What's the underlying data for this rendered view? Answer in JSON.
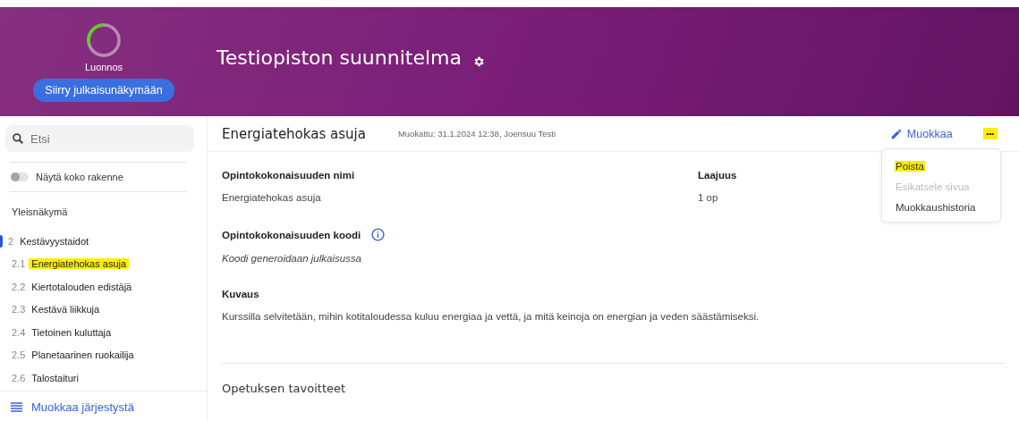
{
  "header": {
    "status": {
      "label": "Luonnos",
      "level": 0.3
    },
    "publish_button": "Siirry julkaisunäkymään",
    "title": "Testiopiston suunnitelma"
  },
  "sidebar": {
    "search": {
      "placeholder": "Etsi"
    },
    "toggle": {
      "label": "Näytä koko rakenne",
      "on": false
    },
    "overview": "Yleisnäkymä",
    "items": [
      {
        "number": "2",
        "label": "Kestävyystaidot",
        "active": true,
        "selected": false,
        "children": [
          {
            "number": "2.1",
            "label": "Energiatehokas asuja",
            "selected": true
          },
          {
            "number": "2.2",
            "label": "Kiertotalouden edistäjä",
            "selected": false
          },
          {
            "number": "2.3",
            "label": "Kestävä liikkuja",
            "selected": false
          },
          {
            "number": "2.4",
            "label": "Tietoinen kuluttaja",
            "selected": false
          },
          {
            "number": "2.5",
            "label": "Planetaarinen ruokailija",
            "selected": false
          },
          {
            "number": "2.6",
            "label": "Talostaituri",
            "selected": false
          }
        ]
      }
    ],
    "reorder_link": "Muokkaa järjestystä"
  },
  "content": {
    "title": "Energiatehokas asuja",
    "modified": "Muokattu: 31.1.2024 12:38, Joensuu Testi",
    "edit_button": "Muokkaa",
    "more_button": {
      "label": "•••",
      "highlighted": true
    },
    "menu": [
      {
        "label": "Poista",
        "highlighted": true,
        "disabled": false
      },
      {
        "label": "Esikatsele sivua",
        "highlighted": false,
        "disabled": true
      },
      {
        "label": "Muokkaushistoria",
        "highlighted": false,
        "disabled": false
      }
    ],
    "fields": [
      {
        "label": "Opintokokonaisuuden nimi",
        "value": "Energiatehokas asuja",
        "info": false,
        "italic": false
      },
      {
        "label": "Laajuus",
        "value": "1  op",
        "info": false,
        "italic": false
      },
      {
        "label": "Opintokokonaisuuden koodi",
        "value": "Koodi generoidaan julkaisussa",
        "info": true,
        "italic": true
      },
      {
        "label": "Kuvaus",
        "value": "Kurssilla selvitetään, mihin kotitaloudessa kuluu energiaa ja vettä, ja mitä keinoja on energian ja veden säästämiseksi.",
        "info": false,
        "italic": false
      }
    ],
    "section_title": "Opetuksen tavoitteet"
  }
}
